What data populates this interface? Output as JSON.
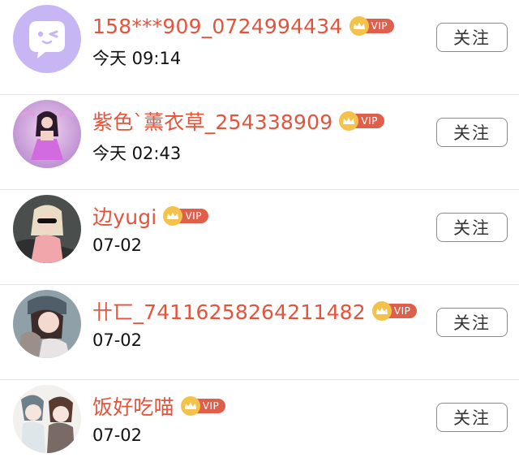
{
  "follow_label": "关注",
  "vip_label": "VIP",
  "users": [
    {
      "name": "158***909_0724994434",
      "time": "今天 09:14",
      "avatar": "purple-chat-bubble-avatar"
    },
    {
      "name": "紫色`薰衣草_254338909",
      "time": "今天 02:43",
      "avatar": "photo-avatar"
    },
    {
      "name": "边yugi",
      "time": "07-02",
      "avatar": "photo-avatar"
    },
    {
      "name": "卄匸_74116258264211482",
      "time": "07-02",
      "avatar": "photo-avatar"
    },
    {
      "name": "饭好吃喵",
      "time": "07-02",
      "avatar": "illustration-avatar"
    }
  ],
  "colors": {
    "name": "#e4543c",
    "vip_tag": "#e05f4b",
    "crown": "#f4c24a",
    "avatar_purple": "#c7b6f3"
  }
}
